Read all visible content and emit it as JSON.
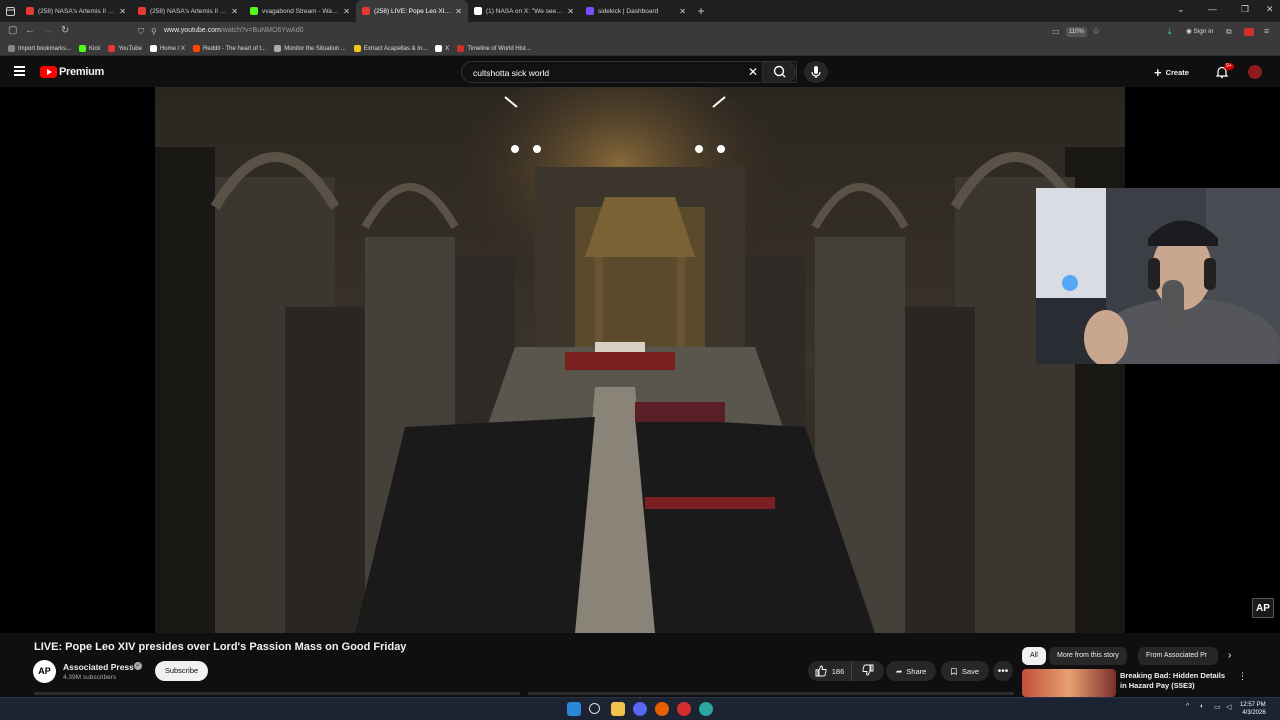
{
  "browser": {
    "tabs": [
      {
        "title": "(258) NASA's Artemis II Live Mi",
        "active": false,
        "favicon_color": "#e53935"
      },
      {
        "title": "(258) NASA's Artemis II Live Mi",
        "active": false,
        "favicon_color": "#e53935"
      },
      {
        "title": "vvagabond Stream - Watch Liv",
        "active": false,
        "favicon_color": "#53fc18"
      },
      {
        "title": "(258) LIVE: Pope Leo XIV p",
        "active": true,
        "favicon_color": "#e53935"
      },
      {
        "title": "(1) NASA on X: \"We see our ho",
        "active": false,
        "favicon_color": "#ffffff"
      },
      {
        "title": "sidekick | Dashboard",
        "active": false,
        "favicon_color": "#7b4dff"
      }
    ],
    "url_host": "www.youtube.com",
    "url_path": "/watch?v=BuNMO6YwAd0",
    "zoom": "110%",
    "signin_label": "Sign in",
    "bookmarks": [
      {
        "label": "Import bookmarks...",
        "color": "#888888"
      },
      {
        "label": "Kick",
        "color": "#53fc18"
      },
      {
        "label": "YouTube",
        "color": "#e53935"
      },
      {
        "label": "Home / X",
        "color": "#ffffff"
      },
      {
        "label": "Reddit - The heart of t...",
        "color": "#ff4500"
      },
      {
        "label": "Monitor the Situation ...",
        "color": "#aaaaaa"
      },
      {
        "label": "Extract Acapellas & In...",
        "color": "#f5c518"
      },
      {
        "label": "X",
        "color": "#ffffff"
      },
      {
        "label": "Timeline of World Hist...",
        "color": "#d03030"
      }
    ]
  },
  "youtube": {
    "logo_text": "Premium",
    "search_query": "cultshotta sick world",
    "create_label": "Create",
    "notifications_badge": "9+",
    "video_title": "LIVE: Pope Leo XIV presides over Lord's Passion Mass on Good Friday",
    "channel_name": "Associated Press",
    "channel_avatar_text": "AP",
    "subscribers": "4.39M subscribers",
    "subscribe_label": "Subscribe",
    "likes": "186",
    "share_label": "Share",
    "save_label": "Save",
    "more_label": "•••",
    "watermark": "AP",
    "chips": [
      "All",
      "More from this story",
      "From Associated Pr"
    ],
    "recommendation": {
      "title": "Breaking Bad: Hidden Details in Hazard Pay (S5E3)"
    }
  },
  "taskbar": {
    "time": "12:57 PM",
    "date": "4/3/2026"
  }
}
